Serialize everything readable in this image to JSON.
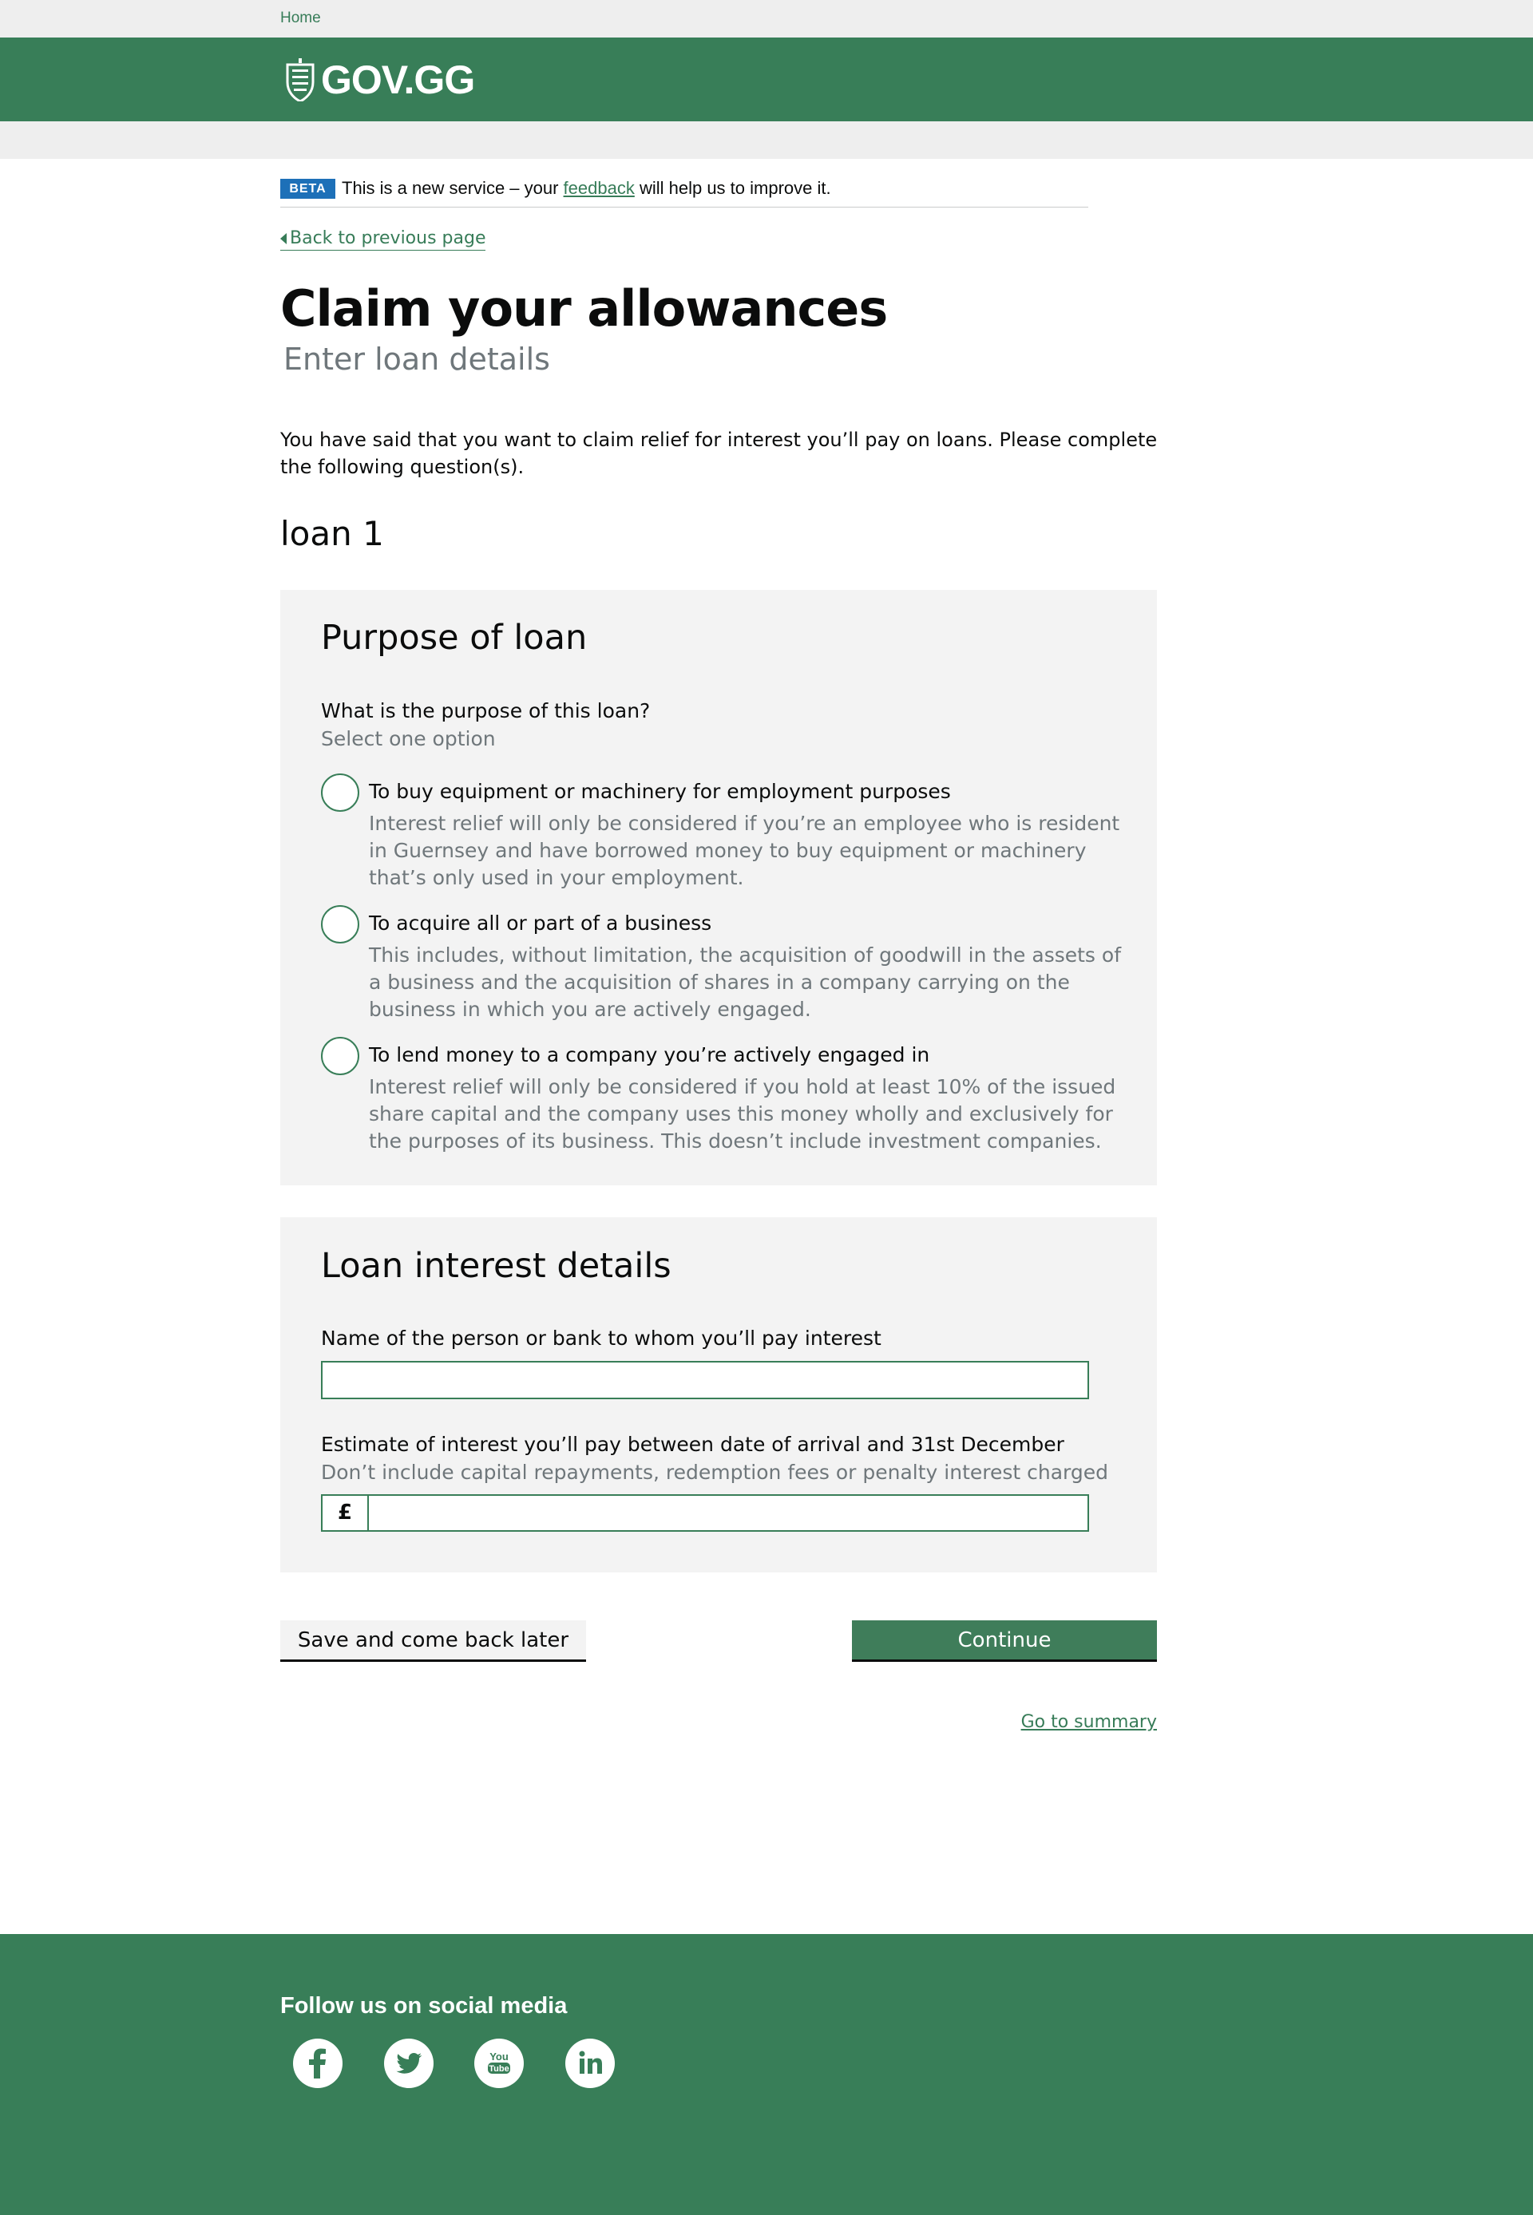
{
  "topbar": {
    "home_link": "Home"
  },
  "header": {
    "logo_text": "GOV.GG"
  },
  "beta_banner": {
    "tag": "BETA",
    "text_before": "This is a new service – your ",
    "link": "feedback",
    "text_after": " will help us to improve it."
  },
  "back_link": "Back to previous page",
  "page": {
    "title": "Claim your allowances",
    "subtitle": "Enter loan details",
    "intro": "You have said that you want to claim relief for interest you’ll pay on loans. Please complete the following question(s).",
    "loan_heading": "loan 1"
  },
  "purpose": {
    "heading": "Purpose of loan",
    "question": "What is the purpose of this loan?",
    "hint": "Select one option",
    "options": [
      {
        "label": "To buy equipment or machinery for employment purposes",
        "hint": "Interest relief will only be considered if you’re an employee who is resident in Guernsey and have borrowed money to buy equipment or machinery that’s only used in your employment."
      },
      {
        "label": "To acquire all or part of a business",
        "hint": "This includes, without limitation, the acquisition of goodwill in the assets of a business and the acquisition of shares in a company carrying on the business in which you are actively engaged."
      },
      {
        "label": "To lend money to a company you’re actively engaged in",
        "hint": "Interest relief will only be considered if you hold at least 10% of the issued share capital and the company uses this money wholly and exclusively for the purposes of its business. This doesn’t include investment companies."
      }
    ]
  },
  "interest": {
    "heading": "Loan interest details",
    "name_label": "Name of the person or bank to whom you’ll pay interest",
    "name_value": "",
    "estimate_label": "Estimate of interest you’ll pay between date of arrival and 31st December",
    "estimate_hint": "Don’t include capital repayments, redemption fees or penalty interest charged",
    "currency_symbol": "£",
    "estimate_value": ""
  },
  "actions": {
    "save_label": "Save and come back later",
    "continue_label": "Continue",
    "summary_link": "Go to summary"
  },
  "footer": {
    "social_heading": "Follow us on social media",
    "icons": [
      "facebook-icon",
      "twitter-icon",
      "youtube-icon",
      "linkedin-icon"
    ]
  },
  "colors": {
    "brand_green": "#387e58",
    "link_green": "#377c58",
    "beta_blue": "#1d70b8",
    "panel_grey": "#f3f3f3"
  }
}
